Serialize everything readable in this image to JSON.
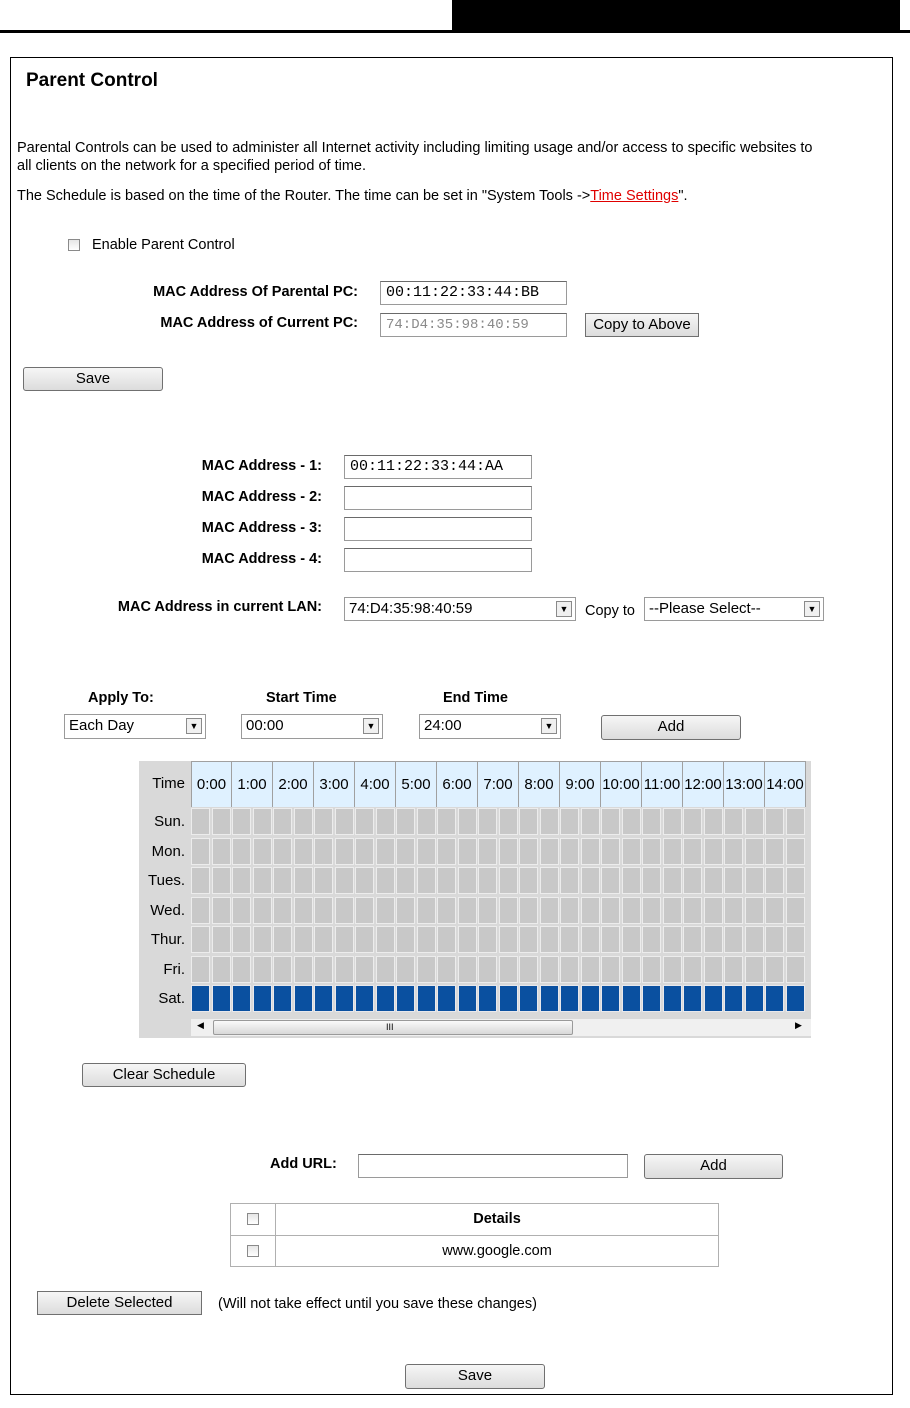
{
  "page": {
    "title": "Parent Control",
    "description_1": "Parental Controls can be used to administer all Internet activity including limiting usage and/or access to specific websites to all clients on the network for a specified period of time.",
    "description_2_prefix": "The Schedule is based on the time of the Router. The time can be set in \"System Tools ->",
    "description_2_link": "Time Settings",
    "description_2_suffix": "\"."
  },
  "enable": {
    "label": "Enable Parent Control",
    "checked": false
  },
  "parental": {
    "mac_parental_label": "MAC Address Of Parental PC:",
    "mac_parental_value": "00:11:22:33:44:BB",
    "mac_current_label": "MAC Address of Current PC:",
    "mac_current_value": "74:D4:35:98:40:59",
    "copy_button": "Copy to Above",
    "save_button": "Save"
  },
  "children": {
    "mac1_label": "MAC Address - 1:",
    "mac1_value": "00:11:22:33:44:AA",
    "mac2_label": "MAC Address - 2:",
    "mac2_value": "",
    "mac3_label": "MAC Address - 3:",
    "mac3_value": "",
    "mac4_label": "MAC Address - 4:",
    "mac4_value": "",
    "lan_label": "MAC Address in current LAN:",
    "lan_selected": "74:D4:35:98:40:59",
    "copy_to_label": "Copy to",
    "copy_to_selected": "--Please Select--"
  },
  "schedule": {
    "apply_label": "Apply To:",
    "apply_selected": "Each Day",
    "start_label": "Start Time",
    "start_selected": "00:00",
    "end_label": "End Time",
    "end_selected": "24:00",
    "add_button": "Add",
    "time_header": "Time",
    "hours": [
      "0:00",
      "1:00",
      "2:00",
      "3:00",
      "4:00",
      "5:00",
      "6:00",
      "7:00",
      "8:00",
      "9:00",
      "10:00",
      "11:00",
      "12:00",
      "13:00",
      "14:00"
    ],
    "days": [
      "Sun.",
      "Mon.",
      "Tues.",
      "Wed.",
      "Thur.",
      "Fri.",
      "Sat."
    ],
    "active_days": [
      "Sat."
    ],
    "scroll_mid": "III",
    "clear_button": "Clear Schedule"
  },
  "urls": {
    "add_url_label": "Add URL:",
    "add_url_value": "",
    "add_button": "Add",
    "details_header": "Details",
    "rows": [
      {
        "url": "www.google.com"
      }
    ],
    "delete_button": "Delete Selected",
    "delete_note": "(Will not take effect until you save these changes)",
    "save_button": "Save"
  },
  "colors": {
    "active_slot": "#0a50a0",
    "inactive_slot": "#c8c8c8",
    "hour_header": "#dff1ff",
    "link": "#e00000"
  }
}
